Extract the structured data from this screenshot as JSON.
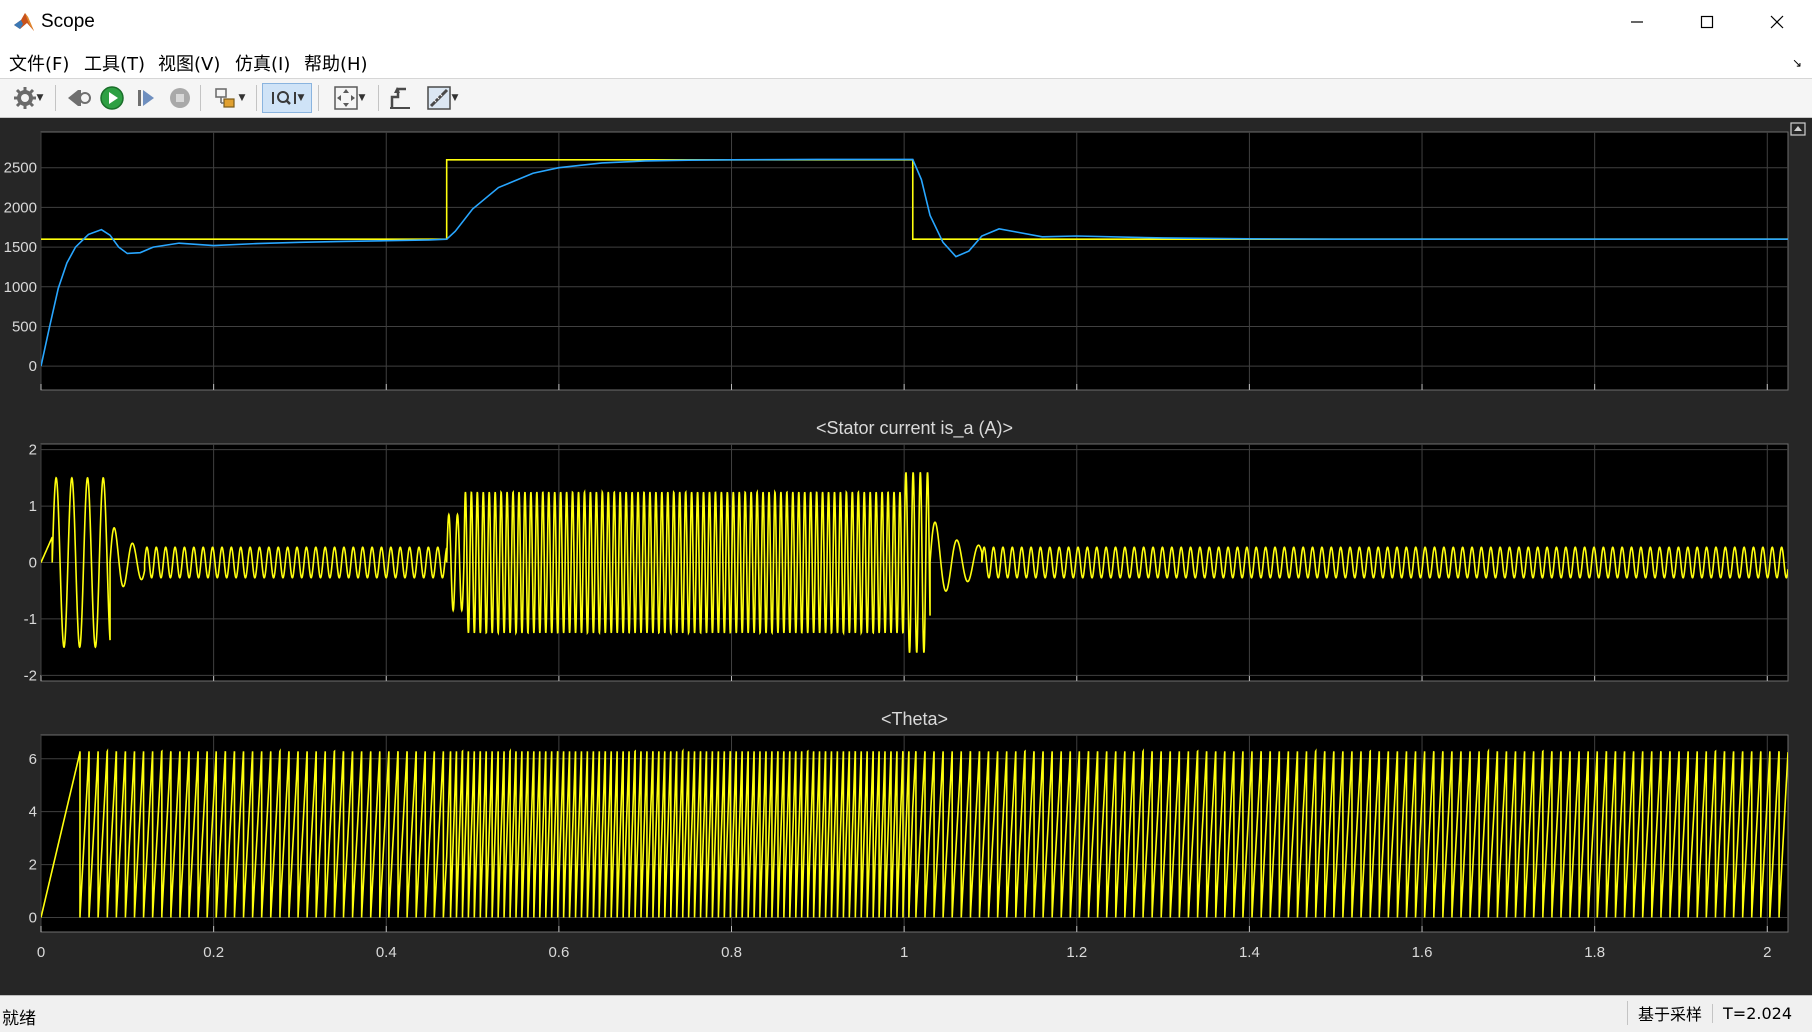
{
  "window": {
    "title": "Scope"
  },
  "menu": [
    "文件(F)",
    "工具(T)",
    "视图(V)",
    "仿真(I)",
    "帮助(H)"
  ],
  "toolbar": {
    "icons": [
      "settings-icon",
      "step-back-icon",
      "run-icon",
      "step-forward-icon",
      "stop-icon",
      "highlight-block-icon",
      "zoom-icon",
      "fit-to-view-icon",
      "triggers-icon",
      "measurements-icon"
    ]
  },
  "status": {
    "left": "就绪",
    "sampling": "基于采样",
    "time": "T=2.024"
  },
  "colors": {
    "plot_bg": "#000000",
    "panel_bg": "#262626",
    "yellow": "#ffff0d",
    "blue": "#28a6ff",
    "grid": "#404040",
    "tick_text": "#d9d9d9"
  },
  "chart_data": [
    {
      "type": "line",
      "title": "",
      "xlim": [
        0,
        2.024
      ],
      "ylim": [
        -300,
        2950
      ],
      "yticks": [
        0,
        500,
        1000,
        1500,
        2000,
        2500
      ],
      "xticks": [
        0,
        0.2,
        0.4,
        0.6,
        0.8,
        1,
        1.2,
        1.4,
        1.6,
        1.8,
        2
      ],
      "grid": true,
      "series": [
        {
          "color": "#ffff0d",
          "kind": "step",
          "x": [
            0,
            0.47,
            0.47,
            1.01,
            1.01,
            2.024
          ],
          "y": [
            1600,
            1600,
            2600,
            2600,
            1600,
            1600
          ]
        },
        {
          "color": "#28a6ff",
          "kind": "line",
          "x": [
            0,
            0.01,
            0.02,
            0.03,
            0.04,
            0.055,
            0.07,
            0.08,
            0.09,
            0.1,
            0.115,
            0.13,
            0.16,
            0.2,
            0.25,
            0.3,
            0.35,
            0.4,
            0.45,
            0.47,
            0.48,
            0.5,
            0.53,
            0.57,
            0.6,
            0.65,
            0.7,
            0.75,
            0.8,
            0.9,
            1.01,
            1.02,
            1.03,
            1.045,
            1.06,
            1.075,
            1.09,
            1.11,
            1.13,
            1.16,
            1.2,
            1.3,
            1.4,
            1.5,
            1.6,
            1.8,
            2.024
          ],
          "y": [
            0,
            500,
            980,
            1300,
            1500,
            1660,
            1720,
            1650,
            1500,
            1420,
            1430,
            1500,
            1550,
            1520,
            1545,
            1560,
            1572,
            1580,
            1590,
            1600,
            1700,
            1980,
            2250,
            2430,
            2500,
            2560,
            2585,
            2595,
            2600,
            2605,
            2605,
            2350,
            1900,
            1560,
            1380,
            1450,
            1640,
            1730,
            1690,
            1630,
            1640,
            1615,
            1605,
            1600,
            1600,
            1600,
            1600
          ]
        }
      ]
    },
    {
      "type": "line",
      "title": "<Stator current is_a (A)>",
      "xlim": [
        0,
        2.024
      ],
      "ylim": [
        -2.1,
        2.1
      ],
      "yticks": [
        -2,
        -1,
        0,
        1,
        2
      ],
      "xticks": [
        0,
        0.2,
        0.4,
        0.6,
        0.8,
        1,
        1.2,
        1.4,
        1.6,
        1.8,
        2
      ],
      "grid": true,
      "series": [
        {
          "color": "#ffff0d",
          "kind": "sine",
          "segments": [
            {
              "x0": 0.0,
              "x1": 0.013,
              "amp": 0.45,
              "freq": 0,
              "offset_ramp": true
            },
            {
              "x0": 0.013,
              "x1": 0.08,
              "amp": 1.5,
              "freq": 55
            },
            {
              "x0": 0.08,
              "x1": 0.12,
              "amp": 0.5,
              "freq": 48,
              "decay": true
            },
            {
              "x0": 0.12,
              "x1": 0.47,
              "amp": 0.27,
              "freq": 92
            },
            {
              "x0": 0.47,
              "x1": 0.49,
              "amp": 0.85,
              "freq": 100
            },
            {
              "x0": 0.49,
              "x1": 1.0,
              "amp": 1.25,
              "freq": 145
            },
            {
              "x0": 1.0,
              "x1": 1.03,
              "amp": 1.6,
              "freq": 120
            },
            {
              "x0": 1.03,
              "x1": 1.09,
              "amp": 0.6,
              "freq": 40,
              "decay": true
            },
            {
              "x0": 1.09,
              "x1": 2.024,
              "amp": 0.27,
              "freq": 92
            }
          ]
        }
      ]
    },
    {
      "type": "line",
      "title": "<Theta>",
      "xlim": [
        0,
        2.024
      ],
      "ylim": [
        -0.55,
        6.9
      ],
      "yticks": [
        0,
        2,
        4,
        6
      ],
      "xticks": [
        0,
        0.2,
        0.4,
        0.6,
        0.8,
        1,
        1.2,
        1.4,
        1.6,
        1.8,
        2
      ],
      "xticklabels": [
        "0",
        "0.2",
        "0.4",
        "0.6",
        "0.8",
        "1",
        "1.2",
        "1.4",
        "1.6",
        "1.8",
        "2"
      ],
      "grid": true,
      "series": [
        {
          "color": "#ffff0d",
          "kind": "sawtooth",
          "max": 6.283,
          "segments": [
            {
              "x0": 0.0,
              "x1": 0.045,
              "freq": 22
            },
            {
              "x0": 0.045,
              "x1": 0.47,
              "freq": 95
            },
            {
              "x0": 0.47,
              "x1": 1.01,
              "freq": 145
            },
            {
              "x0": 1.01,
              "x1": 2.024,
              "freq": 95
            }
          ]
        }
      ]
    }
  ]
}
